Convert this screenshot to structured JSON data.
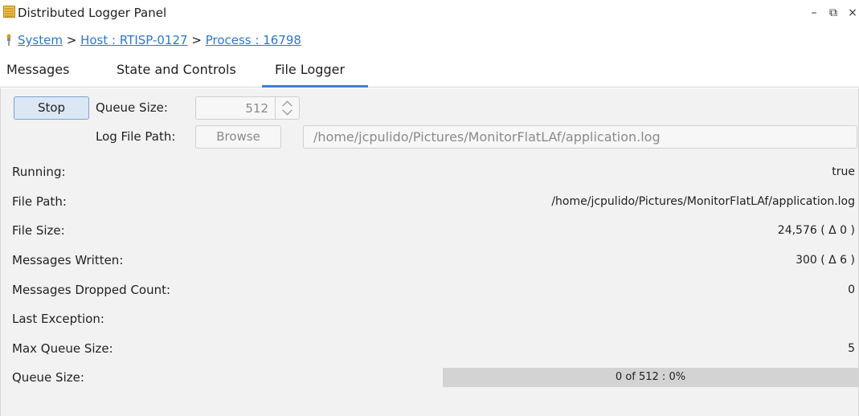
{
  "window": {
    "title": "Distributed Logger Panel",
    "minimize": "–",
    "restore": "⧉",
    "close": "×"
  },
  "breadcrumb": {
    "items": [
      "System",
      "Host : RTISP-0127",
      "Process : 16798"
    ],
    "separator": ">"
  },
  "tabs": [
    "Messages",
    "State and Controls",
    "File Logger"
  ],
  "active_tab": "File Logger",
  "controls": {
    "stop_label": "Stop",
    "queue_size_label": "Queue Size:",
    "queue_size_value": "512",
    "log_file_path_label": "Log File Path:",
    "browse_label": "Browse",
    "log_file_path_value": "/home/jcpulido/Pictures/MonitorFlatLAf/application.log"
  },
  "status": [
    {
      "label": "Running:",
      "value": "true"
    },
    {
      "label": "File Path:",
      "value": "/home/jcpulido/Pictures/MonitorFlatLAf/application.log"
    },
    {
      "label": "File Size:",
      "value": "24,576 ( Δ 0 )"
    },
    {
      "label": "Messages Written:",
      "value": "300 ( Δ 6 )"
    },
    {
      "label": "Messages Dropped Count:",
      "value": "0"
    },
    {
      "label": "Last Exception:",
      "value": ""
    },
    {
      "label": "Max Queue Size:",
      "value": "5"
    }
  ],
  "queue": {
    "label": "Queue Size:",
    "text": "0 of 512 : 0%",
    "fraction": 0
  },
  "colors": {
    "accent": "#3d7ed6",
    "link": "#2c78c9",
    "progress_track": "#d3d3d3"
  }
}
